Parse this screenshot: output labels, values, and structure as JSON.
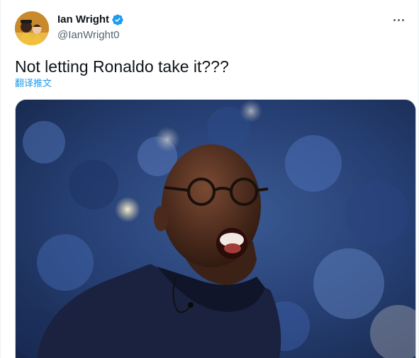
{
  "author": {
    "display_name": "Ian Wright",
    "handle": "@IanWright0",
    "verified": true,
    "avatar_icon": "user-avatar"
  },
  "tweet": {
    "text": "Not letting Ronaldo take it???",
    "translate_label": "翻译推文"
  },
  "media": {
    "type": "photo"
  },
  "colors": {
    "accent": "#1d9bf0",
    "text_primary": "#0f1419",
    "text_secondary": "#536471",
    "border": "#cfd9de"
  },
  "icons": {
    "verified": "verified-badge-icon",
    "more": "more-options-icon"
  }
}
